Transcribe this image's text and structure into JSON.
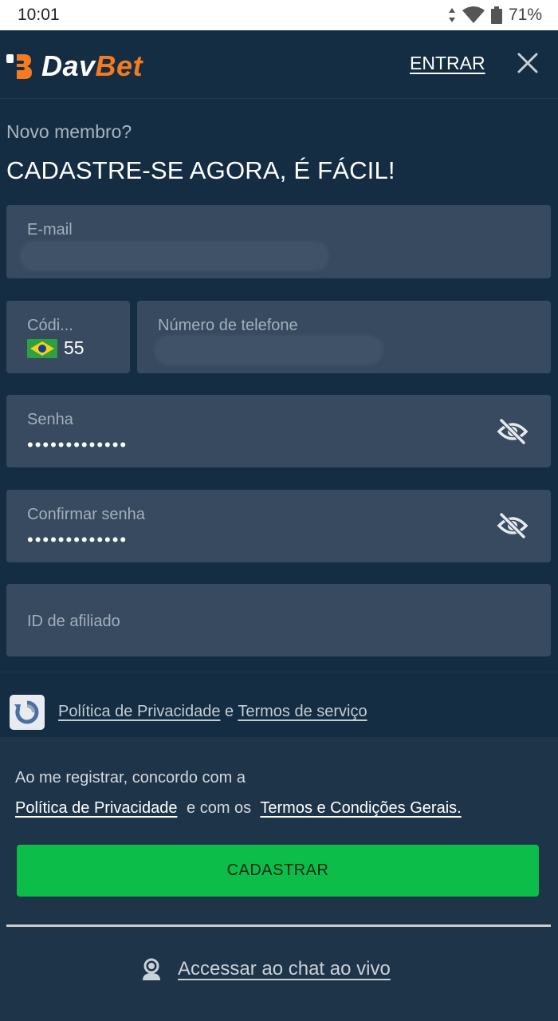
{
  "status_bar": {
    "time": "10:01",
    "battery": "71%"
  },
  "header": {
    "brand_part1": "Dav",
    "brand_part2": "Bet",
    "login_label": "ENTRAR"
  },
  "form": {
    "subtitle": "Novo membro?",
    "title": "CADASTRE-SE AGORA, É FÁCIL!",
    "email_label": "E-mail",
    "code_label": "Códi...",
    "code_value": "55",
    "phone_label": "Número de telefone",
    "password_label": "Senha",
    "password_value": "•••••••••••••",
    "confirm_label": "Confirmar senha",
    "confirm_value": "•••••••••••••",
    "affiliate_label": "ID de afiliado"
  },
  "recaptcha": {
    "privacy_link": "Política de Privacidade",
    "conjunction": "e",
    "terms_link": "Termos de serviço"
  },
  "terms": {
    "line1": "Ao me registrar, concordo com a",
    "privacy_link": "Política de Privacidade",
    "middle": "e com os",
    "terms_link": "Termos e Condições Gerais."
  },
  "register_button": "CADASTRAR",
  "chat_link": "Accessar ao chat ao vivo",
  "colors": {
    "accent_orange": "#f47b20",
    "button_green": "#0dbd4a",
    "background": "#142d42",
    "field_bg": "#374a5f"
  }
}
